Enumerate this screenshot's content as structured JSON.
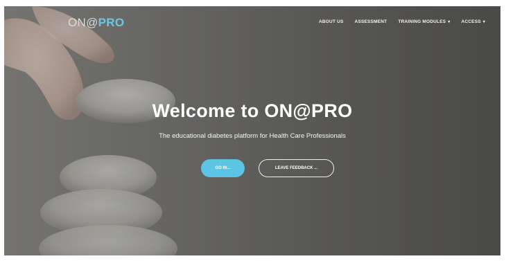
{
  "brand": {
    "prefix": "ON@",
    "accent": "PRO"
  },
  "nav": {
    "items": [
      {
        "label": "ABOUT US",
        "dropdown": false
      },
      {
        "label": "ASSESSMENT",
        "dropdown": false
      },
      {
        "label": "TRAINING MODULES",
        "dropdown": true
      },
      {
        "label": "ACCESS",
        "dropdown": true
      }
    ]
  },
  "hero": {
    "title": "Welcome to ON@PRO",
    "subtitle": "The educational diabetes platform for Health Care Professionals",
    "primary_button": "GO IN...",
    "secondary_button": "LEAVE FEEDBACK ..."
  },
  "colors": {
    "accent": "#5bc5e3",
    "brand_accent": "#6fc6e4",
    "text": "#ffffff"
  }
}
